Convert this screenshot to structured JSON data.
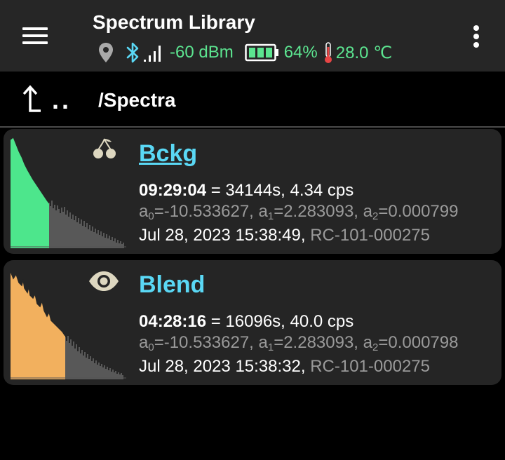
{
  "app_title": "Spectrum Library",
  "status": {
    "signal": "-60 dBm",
    "battery": "64%",
    "temperature": "28.0 ℃",
    "battery_level": 0.64
  },
  "path": "/Spectra",
  "up_label": "..",
  "colors": {
    "accent_green": "#5ce590",
    "link_blue": "#5ad8f5",
    "spectrum_green": "#4de68c",
    "spectrum_orange": "#f2b05e"
  },
  "spectra": [
    {
      "name": "Bckg",
      "icon": "cherries-icon",
      "duration": "09:29:04",
      "stats": " = 34144s, 4.34 cps",
      "a0": "=-10.533627, a",
      "a1": "=2.283093, a",
      "a2": "=0.000799",
      "sub0": "0",
      "sub1": "1",
      "sub2": "2",
      "date": "Jul 28, 2023 15:38:49, ",
      "serial": "RC-101-000275"
    },
    {
      "name": "Blend",
      "icon": "eye-icon",
      "duration": "04:28:16",
      "stats": " = 16096s, 40.0 cps",
      "a0": "=-10.533627, a",
      "a1": "=2.283093, a",
      "a2": "=0.000798",
      "sub0": "0",
      "sub1": "1",
      "sub2": "2",
      "date": "Jul 28, 2023 15:38:32, ",
      "serial": "RC-101-000275"
    }
  ]
}
